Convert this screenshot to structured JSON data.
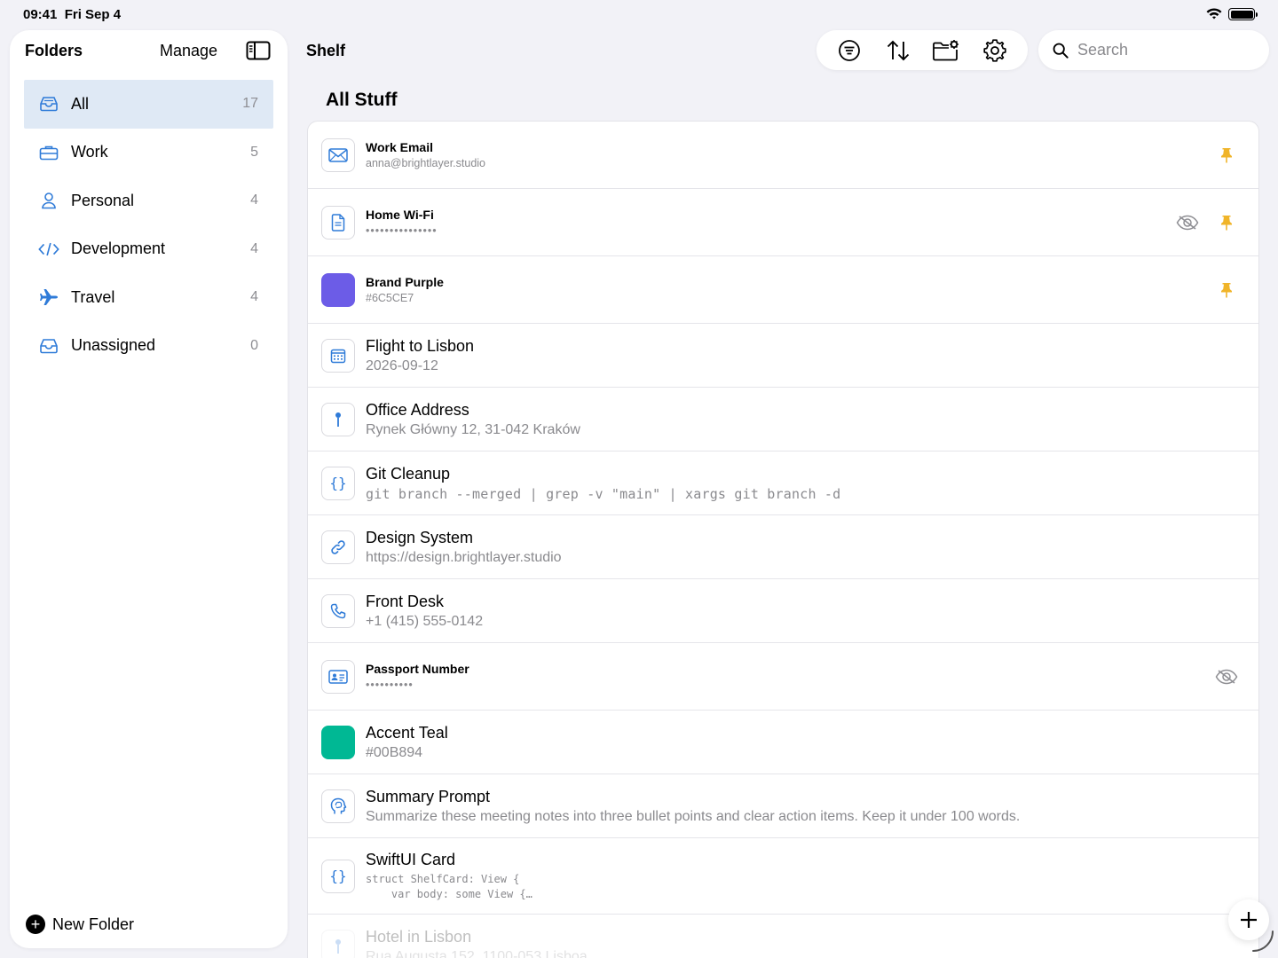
{
  "status": {
    "time": "09:41",
    "date": "Fri Sep 4"
  },
  "sidebar": {
    "title": "Folders",
    "manage_label": "Manage",
    "toggle_icon": "sidebar-toggle-icon",
    "items": [
      {
        "label": "All",
        "count": "17",
        "icon": "tray-icon",
        "active": true
      },
      {
        "label": "Work",
        "count": "5",
        "icon": "briefcase-icon"
      },
      {
        "label": "Personal",
        "count": "4",
        "icon": "person-icon"
      },
      {
        "label": "Development",
        "count": "4",
        "icon": "code-icon"
      },
      {
        "label": "Travel",
        "count": "4",
        "icon": "airplane-icon"
      },
      {
        "label": "Unassigned",
        "count": "0",
        "icon": "tray-icon"
      }
    ],
    "new_folder_label": "New Folder"
  },
  "header": {
    "title": "Shelf",
    "toolbar": [
      "filter-icon",
      "sort-icon",
      "folder-settings-icon",
      "gear-icon"
    ],
    "search_placeholder": "Search"
  },
  "section_title": "All Stuff",
  "items": [
    {
      "title": "Work Email",
      "subtitle": "anna@brightlayer.studio",
      "icon": "envelope-icon",
      "pinned": true
    },
    {
      "title": "Home Wi-Fi",
      "subtitle": "•••••••••••••••",
      "icon": "document-icon",
      "pinned": true,
      "hidden_toggle": true
    },
    {
      "title": "Brand Purple",
      "subtitle": "#6C5CE7",
      "icon": "color-swatch",
      "color": "#6C5CE7",
      "pinned": true
    },
    {
      "title": "Flight to Lisbon",
      "subtitle": "2026-09-12",
      "icon": "calendar-icon"
    },
    {
      "title": "Office Address",
      "subtitle": "Rynek Główny 12, 31-042 Kraków",
      "icon": "pin-icon"
    },
    {
      "title": "Git Cleanup",
      "subtitle": "git branch --merged | grep -v \"main\" | xargs git branch -d",
      "icon": "braces-icon"
    },
    {
      "title": "Design System",
      "subtitle": "https://design.brightlayer.studio",
      "icon": "link-icon"
    },
    {
      "title": "Front Desk",
      "subtitle": "+1 (415) 555-0142",
      "icon": "phone-icon"
    },
    {
      "title": "Passport Number",
      "subtitle": "••••••••••",
      "icon": "id-card-icon",
      "hidden_toggle": true
    },
    {
      "title": "Accent Teal",
      "subtitle": "#00B894",
      "icon": "color-swatch",
      "color": "#00B894"
    },
    {
      "title": "Summary Prompt",
      "subtitle": "Summarize these meeting notes into three bullet points and clear action items. Keep it under 100 words.",
      "icon": "brain-head-icon"
    },
    {
      "title": "SwiftUI Card",
      "subtitle": "struct ShelfCard: View {\n    var body: some View {…",
      "icon": "braces-icon"
    },
    {
      "title": "Hotel in Lisbon",
      "subtitle": "Rua Augusta 152, 1100-053 Lisboa",
      "icon": "pin-icon"
    }
  ],
  "colors": {
    "accent": "#2f7bd8",
    "pin": "#f0b429",
    "active_bg": "#dfe9f5"
  }
}
